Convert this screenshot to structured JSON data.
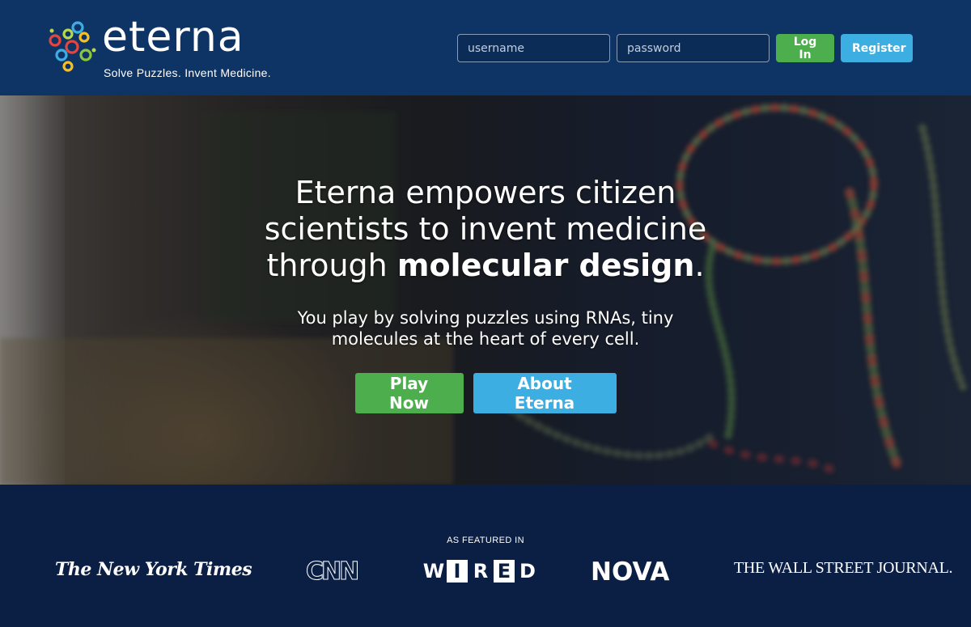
{
  "header": {
    "logo": {
      "wordmark": "eterna",
      "tagline": "Solve Puzzles. Invent Medicine."
    },
    "login": {
      "username_placeholder": "username",
      "password_placeholder": "password",
      "login_label": "Log In",
      "register_label": "Register"
    }
  },
  "hero": {
    "title_line1": "Eterna empowers citizen",
    "title_line2": "scientists to invent medicine",
    "title_line3_prefix": "through ",
    "title_line3_bold": "molecular design",
    "title_line3_suffix": ".",
    "subtitle_line1": "You play by solving puzzles using RNAs, tiny",
    "subtitle_line2": "molecules at the heart of every cell.",
    "play_label": "Play Now",
    "about_label": "About Eterna"
  },
  "featured": {
    "label": "AS FEATURED IN",
    "outlets": {
      "nyt": "The New York Times",
      "cnn": "CNN",
      "wired": [
        "W",
        "I",
        "R",
        "E",
        "D"
      ],
      "nova": "NOVA",
      "wsj": "THE WALL STREET JOURNAL."
    }
  },
  "colors": {
    "header_bg": "#0e3466",
    "footer_bg": "#0b1f45",
    "green": "#4cae4c",
    "blue": "#3daee2"
  },
  "icons": {
    "logo_mark": "rna-rings-logo-icon"
  }
}
